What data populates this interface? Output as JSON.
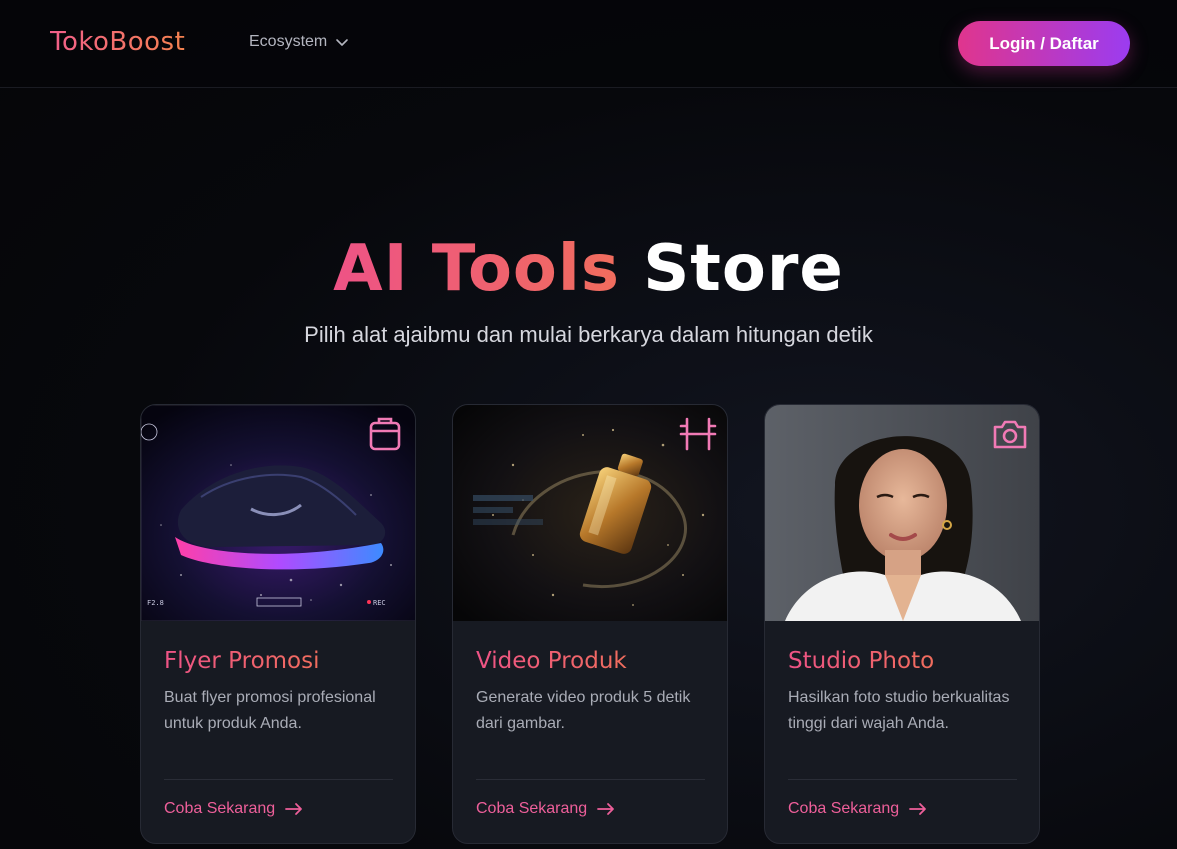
{
  "header": {
    "logo": "TokoBoost",
    "nav_ecosystem": "Ecosystem",
    "login_label": "Login / Daftar"
  },
  "hero": {
    "title_part1": "AI Tools",
    "title_part2": "Store",
    "subtitle": "Pilih alat ajaibmu dan mulai berkarya dalam hitungan detik"
  },
  "cards": [
    {
      "title": "Flyer Promosi",
      "description": "Buat flyer promosi profesional untuk produk Anda.",
      "cta": "Coba Sekarang",
      "icon": "image-frame-icon",
      "image": "sneaker-photo"
    },
    {
      "title": "Video Produk",
      "description": "Generate video produk 5 detik dari gambar.",
      "cta": "Coba Sekarang",
      "icon": "film-icon",
      "image": "perfume-bottle-photo"
    },
    {
      "title": "Studio Photo",
      "description": "Hasilkan foto studio berkualitas tinggi dari wajah Anda.",
      "cta": "Coba Sekarang",
      "icon": "camera-icon",
      "image": "portrait-photo"
    }
  ],
  "colors": {
    "accent_pink": "#ee5386",
    "accent_orange": "#f06d5d",
    "button_gradient_start": "#e0358d",
    "button_gradient_end": "#9b3cf0",
    "background": "#07080c",
    "card_background": "#171a22"
  }
}
